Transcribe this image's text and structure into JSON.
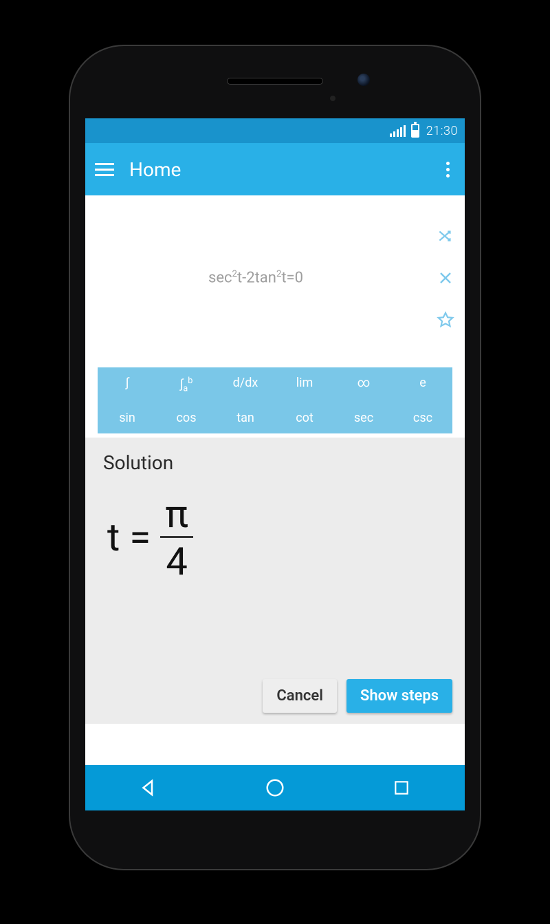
{
  "status": {
    "time": "21:30"
  },
  "appbar": {
    "title": "Home"
  },
  "input": {
    "expression_html": "sec<sup>2</sup>t-2tan<sup>2</sup>t=0"
  },
  "keypad": {
    "row1": [
      "∫",
      "∫ₐᵇ",
      "d/dx",
      "lim",
      "∞",
      "e"
    ],
    "row2": [
      "sin",
      "cos",
      "tan",
      "cot",
      "sec",
      "csc"
    ]
  },
  "solution": {
    "title": "Solution",
    "lhs": "t",
    "eq": "=",
    "numerator": "π",
    "denominator": "4",
    "cancel_label": "Cancel",
    "show_steps_label": "Show steps"
  },
  "icons": {
    "shuffle": "shuffle-icon",
    "clear": "close-icon",
    "favorite": "star-icon"
  }
}
